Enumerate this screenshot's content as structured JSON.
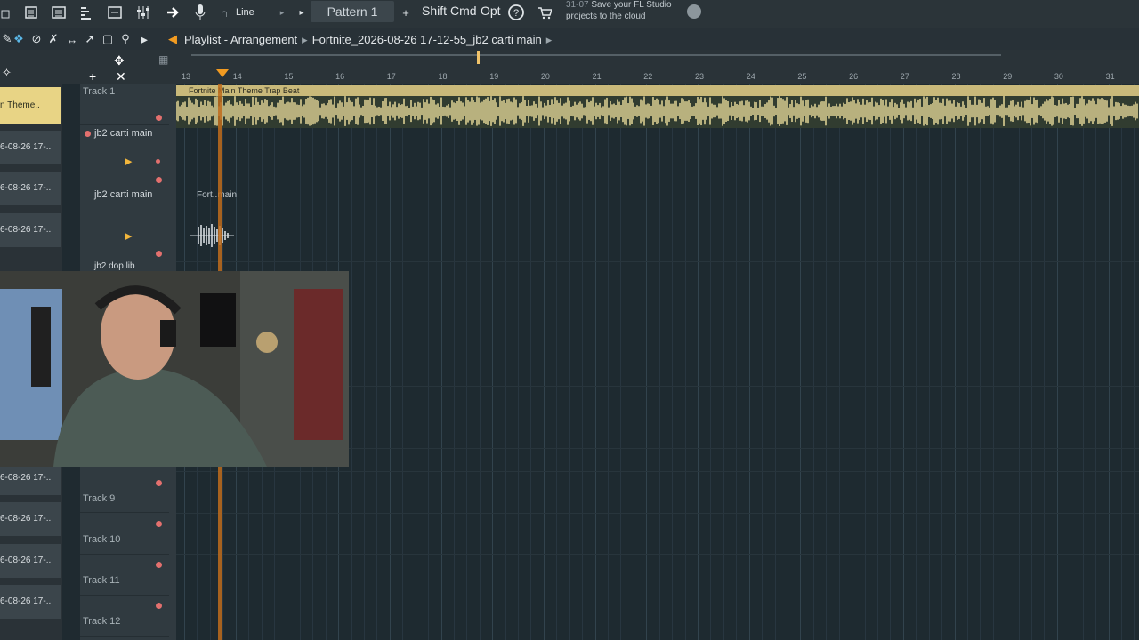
{
  "toolbar": {
    "snap_label": "Line",
    "pattern_label": "Pattern 1",
    "add_label": "+",
    "shift_label": "Shift",
    "cmd_label": "Cmd",
    "opt_label": "Opt",
    "news_date": "31-07",
    "news_text": "Save your FL Studio",
    "news_text2": "projects to the cloud"
  },
  "window": {
    "title": "Playlist - Arrangement",
    "file": "Fortnite_2026-08-26 17-12-55_jb2 carti main",
    "arrow": "▸"
  },
  "ruler": {
    "bars": [
      "13",
      "14",
      "15",
      "16",
      "17",
      "18",
      "19",
      "20",
      "21",
      "22",
      "23",
      "24",
      "25",
      "26",
      "27",
      "28",
      "29",
      "30",
      "31"
    ]
  },
  "picker": {
    "first": "n Theme..",
    "items": [
      "6-08-26 17-..",
      "6-08-26 17-..",
      "6-08-26 17-..",
      "6-08-26 17-..",
      "6-08-26 17-..",
      "6-08-26 17-..",
      "6-08-26 17-.."
    ]
  },
  "tracks": {
    "t1": "Track 1",
    "t2": "jb2 carti main",
    "t3": "jb2 carti main",
    "t4": "jb2 dop lib",
    "t9": "Track 9",
    "t10": "Track 10",
    "t11": "Track 11",
    "t12": "Track 12"
  },
  "clips": {
    "main": "Fortnite Main Theme Trap Beat",
    "fort": "Fort..main"
  },
  "colors": {
    "clip": "#c9b97a",
    "wave": "#f3e3a0",
    "accent": "#f29b21"
  }
}
